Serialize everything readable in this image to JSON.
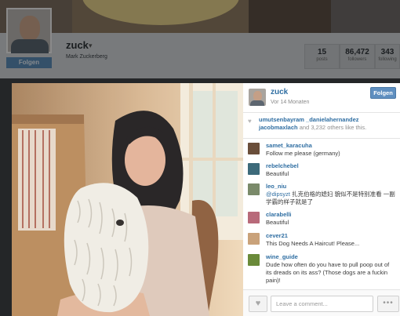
{
  "profile": {
    "username": "zuck",
    "full_name": "Mark Zuckerberg",
    "follow_label": "Folgen",
    "stats": [
      {
        "value": "15",
        "label": "posts"
      },
      {
        "value": "86,472",
        "label": "followers"
      },
      {
        "value": "343",
        "label": "following"
      }
    ]
  },
  "post": {
    "username": "zuck",
    "time": "Vor 14 Monaten",
    "follow_label": "Folgen",
    "likes": {
      "users": [
        "umutsenbayram",
        "_danielahernandez",
        "jacobmaxlach"
      ],
      "and_text": "and",
      "others_count": "3,232",
      "others_text": "others like this."
    },
    "comments": [
      {
        "user": "samet_karacuha",
        "text": "Follow me please (germany)",
        "avatar_color": "#6a4e3a"
      },
      {
        "user": "rebelchebel",
        "text": "Beautiful",
        "avatar_color": "#3d6a7a"
      },
      {
        "user": "leo_niu",
        "mention": "@dipsyzt",
        "text": "扎克伯格的媳妇 貌似不是特别准看 一副学霸的样子就是了",
        "avatar_color": "#7a8a6a"
      },
      {
        "user": "clarabelli",
        "text": "Beautiful",
        "avatar_color": "#b86a7a"
      },
      {
        "user": "cever21",
        "text": "This Dog Needs A Haircut! Please...",
        "avatar_color": "#c9a27a"
      },
      {
        "user": "wine_guide",
        "text": "Dude how often do you have to pull poop out of its dreads on its ass? (Those dogs are a fuckin pain)!",
        "avatar_color": "#6a8a3a"
      }
    ],
    "comment_placeholder": "Leave a comment...",
    "more_label": "•••"
  },
  "icons": {
    "heart": "heart-icon",
    "more": "more-options-icon"
  }
}
